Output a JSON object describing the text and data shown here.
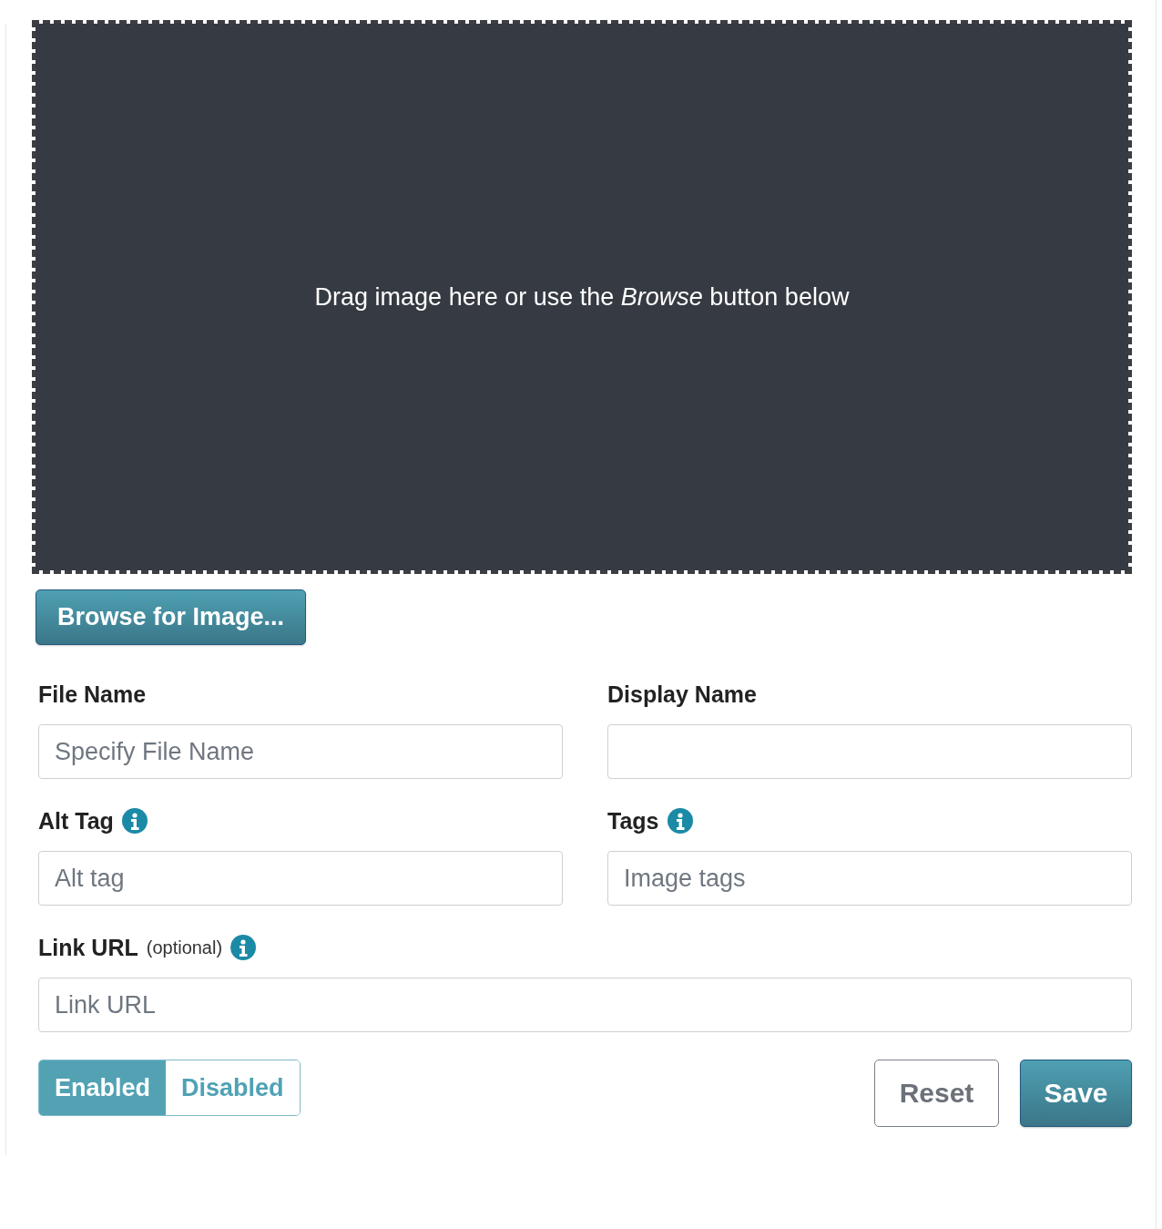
{
  "drop_zone": {
    "text": "Drag image here or use the *Browse* button below"
  },
  "browse_button": "Browse for Image...",
  "rows": [
    [
      {
        "label": "File Name",
        "placeholder": "Specify File Name",
        "info": false
      },
      {
        "label": "Display Name",
        "info": false
      }
    ],
    [
      {
        "label": "Alt Tag",
        "placeholder": "Alt tag",
        "info": true
      },
      {
        "label": "Tags",
        "placeholder": "Image tags",
        "info": true
      }
    ],
    [
      {
        "label": "Link URL",
        "note": "(optional)",
        "placeholder": "Link URL",
        "info": true
      }
    ]
  ],
  "status_toggle": [
    {
      "label": "Enabled",
      "selected": true
    },
    {
      "label": "Disabled",
      "selected": false
    }
  ],
  "buttons": [
    {
      "label": "Reset",
      "kind": "secondary"
    },
    {
      "label": "Save",
      "kind": "primary"
    }
  ]
}
